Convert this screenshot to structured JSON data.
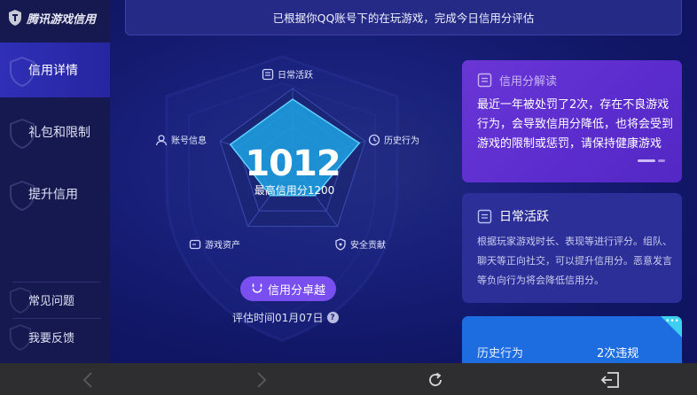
{
  "app": {
    "title": "腾讯游戏信用"
  },
  "sidebar": {
    "items": [
      {
        "label": "信用详情",
        "active": true
      },
      {
        "label": "礼包和限制",
        "active": false
      },
      {
        "label": "提升信用",
        "active": false
      }
    ],
    "bottom_items": [
      {
        "label": "常见问题"
      },
      {
        "label": "我要反馈"
      }
    ]
  },
  "banner": {
    "text": "已根据你QQ账号下的在玩游戏，完成今日信用分评估"
  },
  "radar": {
    "labels": {
      "daily_active": "日常活跃",
      "history": "历史行为",
      "security": "安全贡献",
      "assets": "游戏资产",
      "account": "账号信息"
    },
    "values": {
      "daily_active": 0.86,
      "history": 0.92,
      "security": 0.5,
      "assets": 0.5,
      "account": 0.86
    }
  },
  "score": {
    "value": "1012",
    "max_label": "最高信用分1200"
  },
  "level_button": {
    "label": "信用分卓越"
  },
  "eval_time": {
    "text": "评估时间01月07日",
    "help": "?"
  },
  "cards": {
    "interpretation": {
      "title": "信用分解读",
      "body": "最近一年被处罚了2次，存在不良游戏行为，会导致信用分降低，也将会受到游戏的限制或惩罚，请保持健康游戏"
    },
    "daily": {
      "title": "日常活跃",
      "body": "根据玩家游戏时长、表现等进行评分。组队、聊天等正向社交，可以提升信用分。恶意发言等负向行为将会降低信用分。"
    },
    "history": {
      "label": "历史行为",
      "value": "2次违规"
    }
  },
  "colors": {
    "accent": "#7a4ff0",
    "radar_fill": "#1e9fe0",
    "card_purple": "#5b2ccd",
    "card_blue": "#1d6de0"
  }
}
